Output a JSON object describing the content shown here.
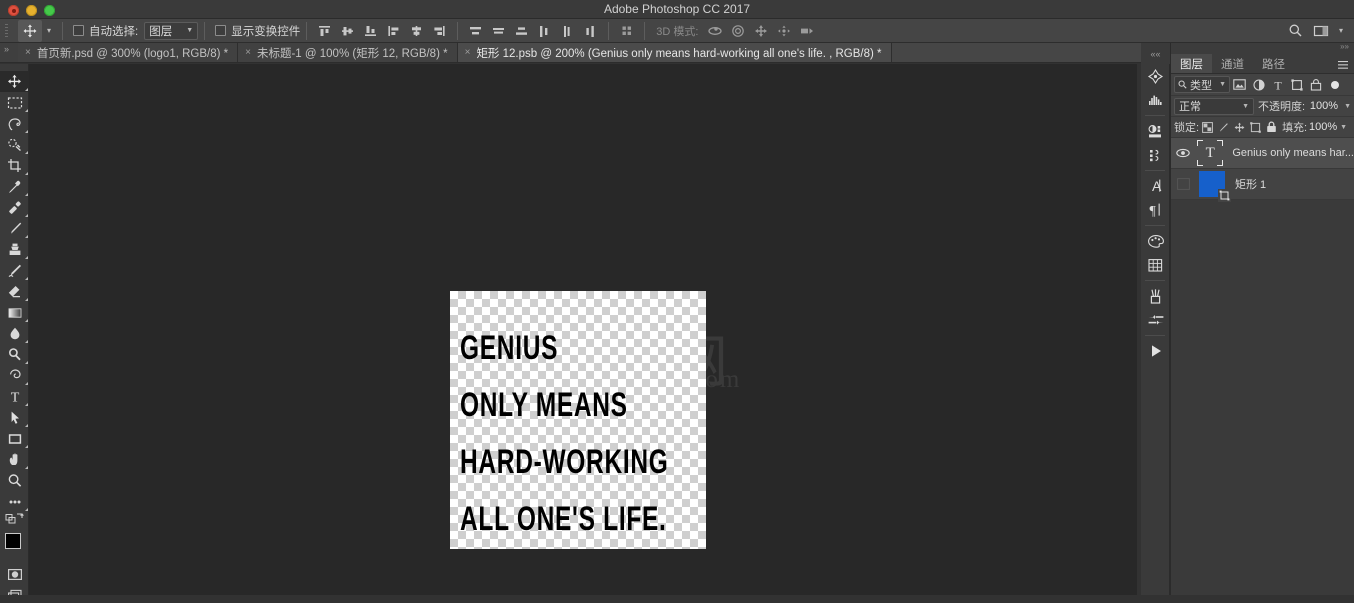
{
  "window": {
    "title": "Adobe Photoshop CC 2017",
    "traffic_lights": [
      "close",
      "minimize",
      "maximize"
    ]
  },
  "options_bar": {
    "tool_icon": "move-tool-icon",
    "auto_select": {
      "label": "自动选择:",
      "checked": false,
      "value": "图层"
    },
    "show_transform": {
      "label": "显示变换控件",
      "checked": false
    },
    "align_icons": [
      "align-top-edges-icon",
      "align-vertical-centers-icon",
      "align-bottom-edges-icon",
      "align-left-edges-icon",
      "align-horizontal-centers-icon",
      "align-right-edges-icon",
      "distribute-top-edges-icon",
      "distribute-vertical-centers-icon",
      "distribute-bottom-edges-icon",
      "distribute-left-edges-icon",
      "distribute-horizontal-centers-icon",
      "distribute-right-edges-icon"
    ],
    "grid_icon": "auto-align-grid-icon",
    "mode_3d_label": "3D 模式:",
    "mode_3d_icons": [
      "rotate-3d-icon",
      "roll-3d-icon",
      "drag-3d-icon",
      "slide-3d-icon",
      "scale-3d-icon"
    ],
    "search_icon": "search-icon",
    "workspace_icon": "workspace-switcher-icon"
  },
  "tabs": [
    {
      "title": "首页新.psd @ 300% (logo1, RGB/8) *",
      "active": false,
      "close": "×"
    },
    {
      "title": "未标题-1 @ 100% (矩形 12, RGB/8) *",
      "active": false,
      "close": "×"
    },
    {
      "title": "矩形 12.psb @ 200% (Genius only means hard-working all one's life. , RGB/8) *",
      "active": true,
      "close": "×"
    }
  ],
  "toolbar": {
    "tools": [
      {
        "name": "move-tool",
        "selected": true,
        "has_flyout": true
      },
      {
        "name": "rectangular-marquee-tool",
        "selected": false,
        "has_flyout": true
      },
      {
        "name": "lasso-tool",
        "selected": false,
        "has_flyout": true
      },
      {
        "name": "quick-selection-tool",
        "selected": false,
        "has_flyout": true
      },
      {
        "name": "crop-tool",
        "selected": false,
        "has_flyout": true
      },
      {
        "name": "eyedropper-tool",
        "selected": false,
        "has_flyout": true
      },
      {
        "name": "spot-healing-brush-tool",
        "selected": false,
        "has_flyout": true
      },
      {
        "name": "brush-tool",
        "selected": false,
        "has_flyout": true
      },
      {
        "name": "clone-stamp-tool",
        "selected": false,
        "has_flyout": true
      },
      {
        "name": "history-brush-tool",
        "selected": false,
        "has_flyout": true
      },
      {
        "name": "eraser-tool",
        "selected": false,
        "has_flyout": true
      },
      {
        "name": "gradient-tool",
        "selected": false,
        "has_flyout": true
      },
      {
        "name": "blur-tool",
        "selected": false,
        "has_flyout": true
      },
      {
        "name": "dodge-tool",
        "selected": false,
        "has_flyout": true
      },
      {
        "name": "pen-tool",
        "selected": false,
        "has_flyout": true
      },
      {
        "name": "horizontal-type-tool",
        "selected": false,
        "has_flyout": true
      },
      {
        "name": "path-selection-tool",
        "selected": false,
        "has_flyout": true
      },
      {
        "name": "rectangle-tool",
        "selected": false,
        "has_flyout": true
      },
      {
        "name": "hand-tool",
        "selected": false,
        "has_flyout": true
      },
      {
        "name": "zoom-tool",
        "selected": false,
        "has_flyout": false
      },
      {
        "name": "edit-toolbar-more",
        "selected": false,
        "has_flyout": true
      }
    ],
    "foreground_color": "#000000",
    "background_color": "#ffffff",
    "quick_mask_icon": "quick-mask-icon",
    "screen_mode_icon": "screen-mode-icon"
  },
  "canvas": {
    "watermark": {
      "text": "CXi网",
      "sub": ".com"
    },
    "artboard": {
      "background": "transparent-checker",
      "text_lines": [
        "GENIUS",
        "ONLY MEANS",
        "HARD-WORKING",
        "ALL ONE'S LIFE."
      ],
      "text_color": "#000000"
    }
  },
  "rail": {
    "collapse_icon": "collapse-panels-icon",
    "items": [
      "3d-panel-icon",
      "histogram-panel-icon",
      "adjustments-panel-icon",
      "info-panel-icon",
      "character-panel-icon",
      "paragraph-panel-icon",
      "color-panel-icon",
      "swatches-panel-icon",
      "brush-settings-panel-icon",
      "brush-presets-panel-icon",
      "timeline-play-icon"
    ]
  },
  "layers_panel": {
    "tabs": [
      {
        "label": "图层",
        "active": true
      },
      {
        "label": "通道",
        "active": false
      },
      {
        "label": "路径",
        "active": false
      }
    ],
    "menu_icon": "panel-menu-icon",
    "filter": {
      "kind_label": "类型",
      "search_icon": "search-icon",
      "icons": [
        "filter-pixel-icon",
        "filter-adjustment-icon",
        "filter-type-icon",
        "filter-shape-icon",
        "filter-smart-object-icon"
      ],
      "toggle_icon": "filter-toggle-icon"
    },
    "blend_mode": "正常",
    "opacity_label": "不透明度:",
    "opacity_value": "100%",
    "lock_label": "锁定:",
    "lock_icons": [
      "lock-transparent-pixels-icon",
      "lock-image-pixels-icon",
      "lock-position-icon",
      "lock-artboard-nesting-icon",
      "lock-all-icon"
    ],
    "fill_label": "填充:",
    "fill_value": "100%",
    "layers": [
      {
        "name": "Genius only means har...",
        "visible": true,
        "selected": true,
        "thumb_type": "text",
        "thumb_glyph": "T"
      },
      {
        "name": "矩形 1",
        "visible": false,
        "selected": false,
        "thumb_type": "shape",
        "thumb_color": "#1660cb"
      }
    ]
  }
}
